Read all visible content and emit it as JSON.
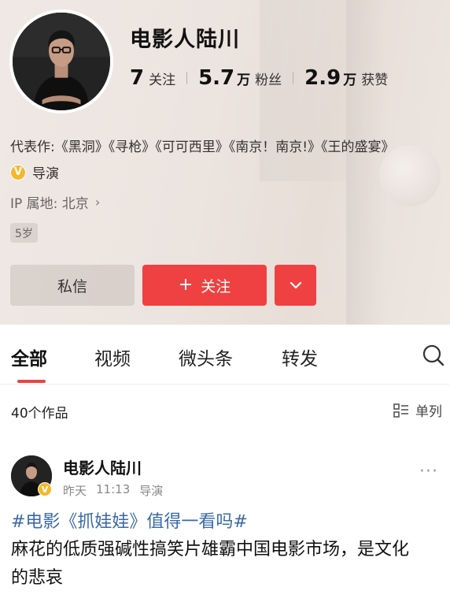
{
  "profile": {
    "name": "电影人陆川",
    "stats": [
      {
        "number": "7",
        "unit": "",
        "label": "关注"
      },
      {
        "number": "5.7",
        "unit": "万",
        "label": "粉丝"
      },
      {
        "number": "2.9",
        "unit": "万",
        "label": "获赞"
      }
    ],
    "works": "代表作:《黑洞》《寻枪》《可可西里》《南京！南京!》《王的盛宴》",
    "verify_badge": "V",
    "verify_title": "导演",
    "ip_location": "IP 属地: 北京",
    "ip_chevron": "›",
    "age_chip": "5岁",
    "message_button": "私信",
    "follow_plus": "+",
    "follow_button": "关注",
    "accent_color": "#f04142"
  },
  "tabs": [
    {
      "label": "全部",
      "active": true
    },
    {
      "label": "视频",
      "active": false
    },
    {
      "label": "微头条",
      "active": false
    },
    {
      "label": "转发",
      "active": false
    }
  ],
  "list_header": {
    "count": "40个作品",
    "view_mode": "单列"
  },
  "post": {
    "author": "电影人陆川",
    "badge": "V",
    "date": "昨天",
    "time": "11:13",
    "title": "导演",
    "more": "···",
    "topic": "#电影《抓娃娃》值得一看吗#",
    "body": "麻花的低质强碱性搞笑片雄霸中国电影市场，是文化的悲哀",
    "topic_color": "#3a6aa6"
  },
  "icons": {
    "search": "search-icon",
    "chevron_down": "chevron-down-icon",
    "list_view": "list-view-icon",
    "verified": "verified-badge-icon"
  }
}
